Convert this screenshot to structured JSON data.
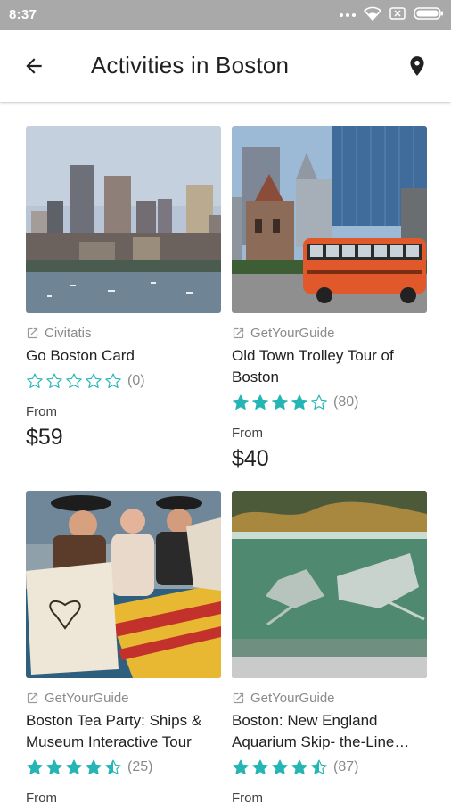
{
  "status_bar": {
    "time": "8:37",
    "icons": [
      "dots-icon",
      "wifi-icon",
      "sim-icon",
      "battery-icon"
    ]
  },
  "app_bar": {
    "title": "Activities in Boston",
    "back_icon": "arrow-back-icon",
    "map_icon": "location-pin-icon"
  },
  "colors": {
    "star": "#26b5b5",
    "status_bar_bg": "#a9a9a9"
  },
  "activities": [
    {
      "provider": "Civitatis",
      "title": "Go Boston Card",
      "rating": 0,
      "review_count": "(0)",
      "from_label": "From",
      "price": "$59",
      "image": "boston-skyline-harbor"
    },
    {
      "provider": "GetYourGuide",
      "title": "Old Town Trolley Tour of Boston",
      "rating": 4,
      "review_count": "(80)",
      "from_label": "From",
      "price": "$40",
      "image": "orange-trolley-city"
    },
    {
      "provider": "GetYourGuide",
      "title": "Boston Tea Party: Ships & Museum Interactive Tour",
      "rating": 4.5,
      "review_count": "(25)",
      "from_label": "From",
      "price": "",
      "image": "tea-party-actors-ship"
    },
    {
      "provider": "GetYourGuide",
      "title": "Boston: New England Aquarium Skip- the-Line…",
      "rating": 4.5,
      "review_count": "(87)",
      "from_label": "From",
      "price": "",
      "image": "aquarium-stingrays"
    }
  ]
}
